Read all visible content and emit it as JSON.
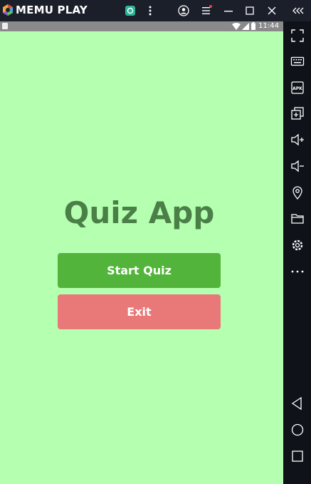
{
  "window": {
    "brand": "MEMU PLAY",
    "icons": [
      "app-store-icon",
      "more-vertical-icon",
      "account-icon",
      "menu-icon",
      "minimize-icon",
      "maximize-icon",
      "close-icon",
      "collapse-sidebar-icon"
    ]
  },
  "status_bar": {
    "time": "11:44",
    "icons": [
      "notification-icon",
      "wifi-icon",
      "signal-icon",
      "battery-icon"
    ]
  },
  "app": {
    "title": "Quiz App",
    "start_label": "Start Quiz",
    "exit_label": "Exit",
    "colors": {
      "background": "#b5ffb0",
      "title": "#4a7f48",
      "start": "#52b43a",
      "exit": "#e97878"
    }
  },
  "sidebar": {
    "icons": [
      "fullscreen-icon",
      "keyboard-icon",
      "apk-icon",
      "multi-instance-icon",
      "volume-up-icon",
      "volume-down-icon",
      "location-icon",
      "folder-icon",
      "settings-icon",
      "more-icon",
      "back-icon",
      "home-icon",
      "recents-icon"
    ]
  }
}
